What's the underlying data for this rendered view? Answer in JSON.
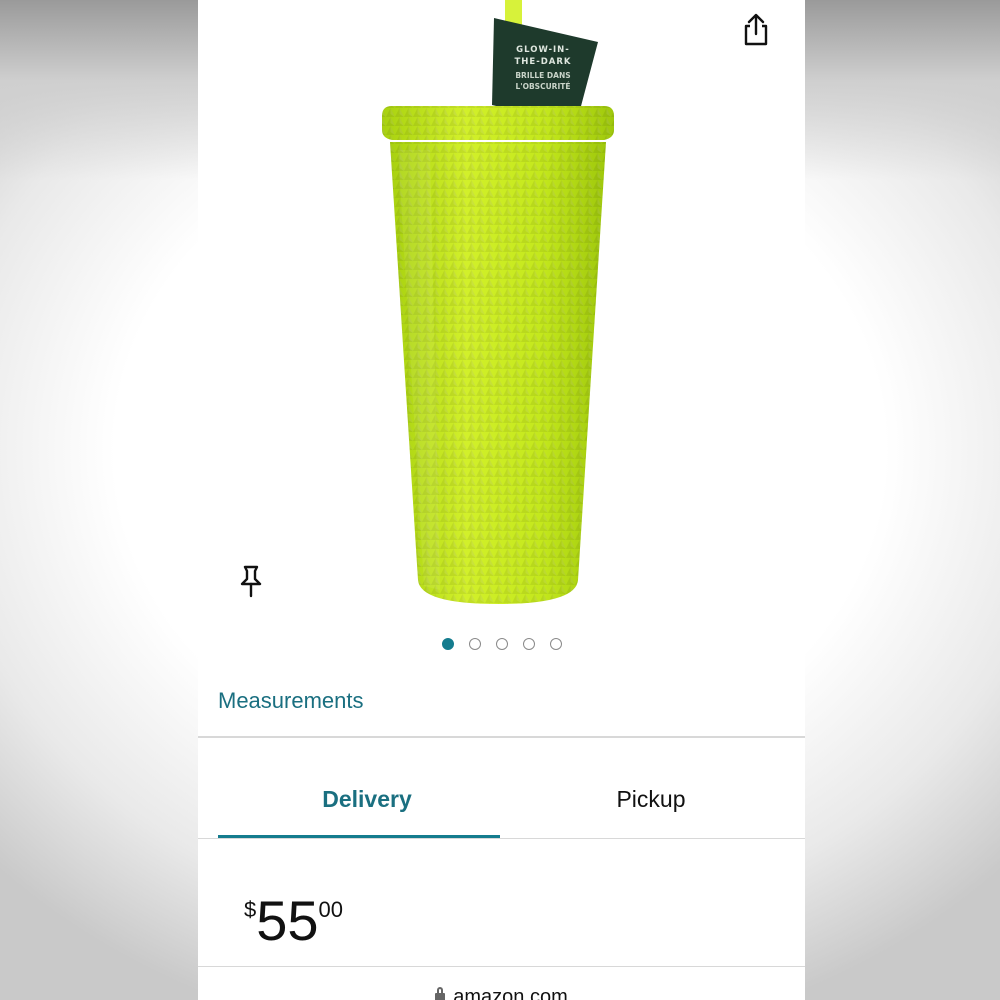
{
  "product": {
    "tag_line1": "GLOW-IN-",
    "tag_line2": "THE-DARK",
    "tag_line3": "BRILLE DANS",
    "tag_line4": "L'OBSCURITÉ",
    "image_count": 5,
    "active_image": 1
  },
  "links": {
    "measurements": "Measurements"
  },
  "tabs": {
    "delivery": "Delivery",
    "pickup": "Pickup",
    "active": "Delivery"
  },
  "price": {
    "symbol": "$",
    "whole": "55",
    "fraction": "00"
  },
  "browser": {
    "url": "amazon.com"
  },
  "icons": {
    "share": "share-icon",
    "pin": "pushpin-icon",
    "lock": "lock-icon"
  },
  "colors": {
    "accent": "#147c8e",
    "link": "#1a6f80",
    "tumbler": "#c6ea1a",
    "tag": "#1e3a2c"
  }
}
